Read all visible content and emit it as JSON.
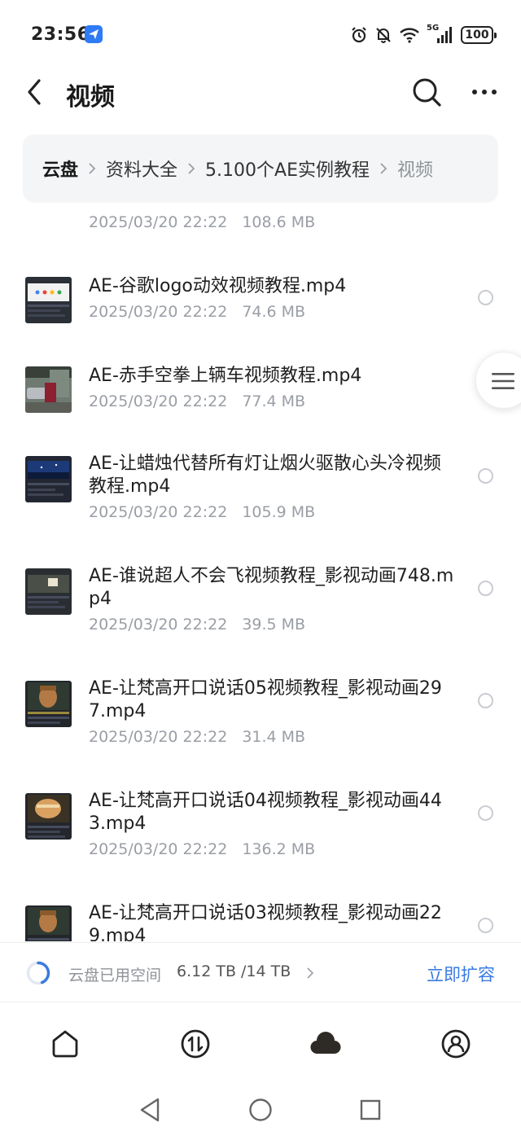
{
  "status_bar": {
    "time": "23:56",
    "network_label": "5G",
    "battery": "100",
    "icons": [
      "app-notification-icon",
      "alarm-icon",
      "mute-icon",
      "wifi-icon",
      "signal-icon",
      "battery-icon"
    ]
  },
  "header": {
    "title": "视频",
    "icons": [
      "back-icon",
      "search-icon",
      "more-icon"
    ]
  },
  "breadcrumb": {
    "items": [
      "云盘",
      "资料大全",
      "5.100个AE实例教程",
      "视频"
    ]
  },
  "files": [
    {
      "name": "",
      "date": "2025/03/20 22:22",
      "size": "108.6 MB"
    },
    {
      "name": "AE-谷歌logo动效视频教程.mp4",
      "date": "2025/03/20 22:22",
      "size": "74.6 MB"
    },
    {
      "name": "AE-赤手空拳上辆车视频教程.mp4",
      "date": "2025/03/20 22:22",
      "size": "77.4 MB"
    },
    {
      "name": "AE-让蜡烛代替所有灯让烟火驱散心头冷视频教程.mp4",
      "date": "2025/03/20 22:22",
      "size": "105.9 MB"
    },
    {
      "name": "AE-谁说超人不会飞视频教程_影视动画748.mp4",
      "date": "2025/03/20 22:22",
      "size": "39.5 MB"
    },
    {
      "name": "AE-让梵高开口说话05视频教程_影视动画297.mp4",
      "date": "2025/03/20 22:22",
      "size": "31.4 MB"
    },
    {
      "name": "AE-让梵高开口说话04视频教程_影视动画443.mp4",
      "date": "2025/03/20 22:22",
      "size": "136.2 MB"
    },
    {
      "name": "AE-让梵高开口说话03视频教程_影视动画229.mp4",
      "date": "",
      "size": ""
    }
  ],
  "storage": {
    "label": "云盘已用空间",
    "value": "6.12 TB /14 TB",
    "used_fraction": 0.437,
    "action": "立即扩容",
    "accent_color": "#3a7be0"
  },
  "bottom_nav": {
    "items": [
      "home-icon",
      "transfer-icon",
      "cloud-icon",
      "profile-icon"
    ],
    "active": "cloud-icon"
  },
  "system_nav": [
    "system-back-icon",
    "system-home-icon",
    "system-recents-icon"
  ]
}
